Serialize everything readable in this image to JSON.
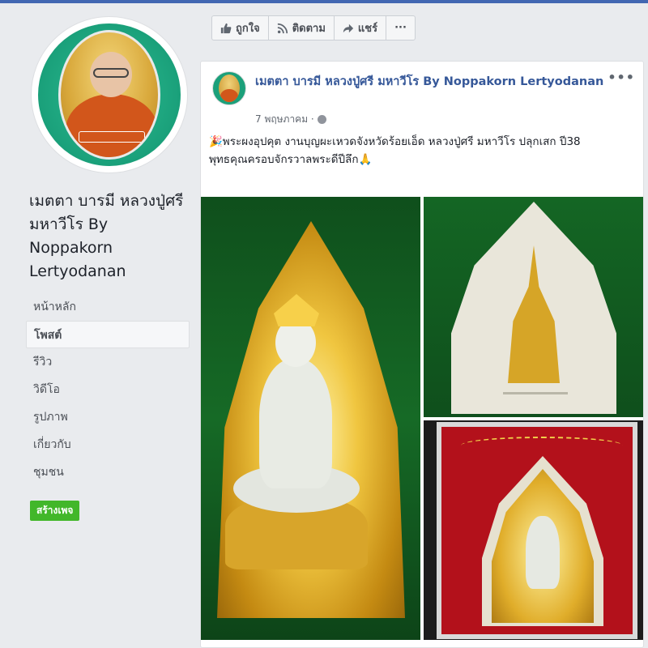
{
  "page": {
    "name": "เมตตา บารมี หลวงปู่ศรี มหาวีโร By Noppakorn Lertyodanan",
    "create_page_label": "สร้างเพจ"
  },
  "nav": {
    "items": [
      {
        "label": "หน้าหลัก",
        "active": false
      },
      {
        "label": "โพสต์",
        "active": true
      },
      {
        "label": "รีวิว",
        "active": false
      },
      {
        "label": "วิดีโอ",
        "active": false
      },
      {
        "label": "รูปภาพ",
        "active": false
      },
      {
        "label": "เกี่ยวกับ",
        "active": false
      },
      {
        "label": "ชุมชน",
        "active": false
      }
    ]
  },
  "actions": {
    "like": "ถูกใจ",
    "follow": "ติดตาม",
    "share": "แชร์",
    "more": "···"
  },
  "post": {
    "author": "เมตตา บารมี หลวงปู่ศรี มหาวีโร By Noppakorn Lertyodanan",
    "date": "7 พฤษภาคม ·",
    "more": "•••",
    "text_line1": "🎉พระผงอุปคุต งานบุญผะเหวดจังหวัดร้อยเอ็ด หลวงปู่ศรี มหาวีโร ปลุกเสก ปี38",
    "text_line2": "พุทธคุณครอบจักรวาลพระดีปีลึก🙏"
  },
  "colors": {
    "link_blue": "#365899",
    "create_green": "#42b72a",
    "background": "#e9ebee"
  }
}
